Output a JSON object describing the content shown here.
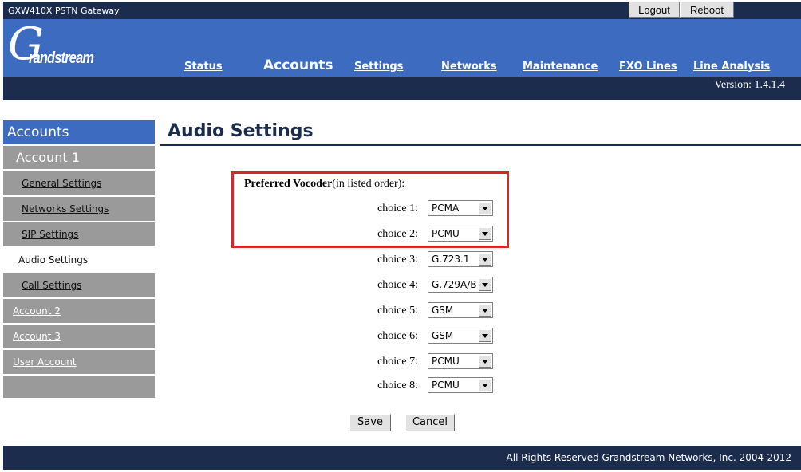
{
  "topbar": {
    "device_name": "GXW410X PSTN Gateway",
    "logout_label": "Logout",
    "reboot_label": "Reboot"
  },
  "header": {
    "logo_g": "G",
    "logo_text": "randstream",
    "nav": {
      "status": "Status",
      "accounts": "Accounts",
      "settings": "Settings",
      "networks": "Networks",
      "maintenance": "Maintenance",
      "fxo_lines": "FXO Lines",
      "line_analysis": "Line Analysis"
    },
    "version": "Version: 1.4.1.4"
  },
  "sidebar": {
    "title": "Accounts",
    "current_account": "Account 1",
    "items": {
      "general": "General Settings",
      "networks": "Networks Settings",
      "sip": "SIP Settings",
      "audio": "Audio Settings",
      "call": "Call Settings"
    },
    "account2": "Account 2",
    "account3": "Account 3",
    "user_account": "User Account"
  },
  "main": {
    "page_title": "Audio Settings",
    "preferred_vocoder_bold": "Preferred Vocoder",
    "preferred_vocoder_rest": "(in listed order):",
    "choices": [
      {
        "label": "choice 1:",
        "value": "PCMA"
      },
      {
        "label": "choice 2:",
        "value": "PCMU"
      },
      {
        "label": "choice 3:",
        "value": "G.723.1"
      },
      {
        "label": "choice 4:",
        "value": "G.729A/B"
      },
      {
        "label": "choice 5:",
        "value": "GSM"
      },
      {
        "label": "choice 6:",
        "value": "GSM"
      },
      {
        "label": "choice 7:",
        "value": "PCMU"
      },
      {
        "label": "choice 8:",
        "value": "PCMU"
      }
    ],
    "save_label": "Save",
    "cancel_label": "Cancel"
  },
  "footer": {
    "copyright": "All Rights Reserved Grandstream Networks, Inc. 2004-2012"
  },
  "colors": {
    "header_blue": "#3d6bbf",
    "dark_navy": "#1c2c4d",
    "sidebar_gray": "#9a9a9a",
    "highlight_red": "#d62828"
  }
}
